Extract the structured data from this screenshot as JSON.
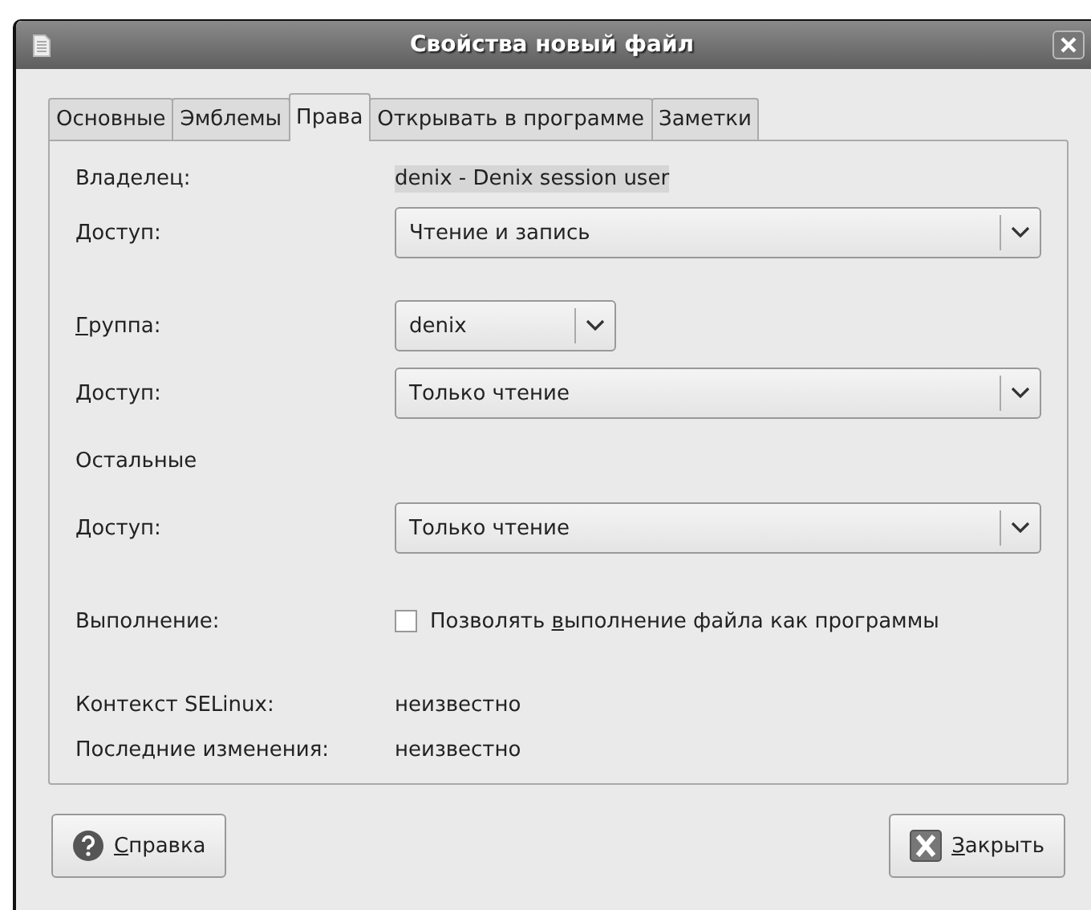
{
  "window": {
    "title": "Свойства новый файл"
  },
  "tabs": [
    {
      "label": "Основные",
      "selected": false
    },
    {
      "label": "Эмблемы",
      "selected": false
    },
    {
      "label": "Права",
      "selected": true
    },
    {
      "label": "Открывать в программе",
      "selected": false
    },
    {
      "label": "Заметки",
      "selected": false
    }
  ],
  "rows": [
    {
      "kind": "text",
      "label": {
        "before": "Владелец:"
      },
      "value": "denix - Denix session user",
      "highlighted": true
    },
    {
      "kind": "combo",
      "label": {
        "before": "Доступ:"
      },
      "value": "Чтение и запись",
      "wide": true
    },
    {
      "kind": "gap"
    },
    {
      "kind": "combo",
      "label": {
        "key": "Г",
        "after": "руппа:"
      },
      "value": "denix",
      "wide": false
    },
    {
      "kind": "combo",
      "label": {
        "before": "Доступ:"
      },
      "value": "Только чтение",
      "wide": true
    },
    {
      "kind": "heading",
      "label": {
        "before": "Остальные"
      }
    },
    {
      "kind": "combo",
      "label": {
        "before": "Доступ:"
      },
      "value": "Только чтение",
      "wide": true
    },
    {
      "kind": "gap"
    },
    {
      "kind": "check",
      "label": {
        "before": "Выполнение:"
      },
      "checked": false,
      "check_label": {
        "before": "Позволять ",
        "key": "в",
        "after": "ыполнение файла как программы"
      }
    },
    {
      "kind": "gap"
    },
    {
      "kind": "text",
      "label": {
        "before": "Контекст SELinux:"
      },
      "value": "неизвестно",
      "highlighted": false
    },
    {
      "kind": "text",
      "label": {
        "before": "Последние изменения:"
      },
      "value": "неизвестно",
      "highlighted": false
    }
  ],
  "buttons": [
    {
      "kind": "help",
      "label": {
        "key": "С",
        "after": "правка"
      }
    },
    {
      "kind": "close",
      "label": {
        "key": "З",
        "after": "акрыть"
      }
    }
  ]
}
